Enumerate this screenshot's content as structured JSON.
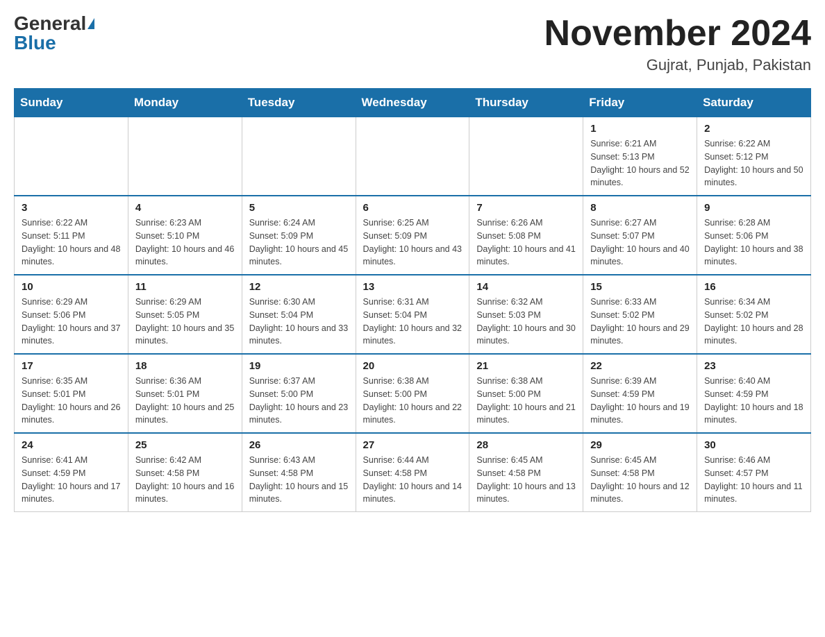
{
  "header": {
    "logo_general": "General",
    "logo_blue": "Blue",
    "month_title": "November 2024",
    "location": "Gujrat, Punjab, Pakistan"
  },
  "weekdays": [
    "Sunday",
    "Monday",
    "Tuesday",
    "Wednesday",
    "Thursday",
    "Friday",
    "Saturday"
  ],
  "weeks": [
    [
      {
        "day": "",
        "info": ""
      },
      {
        "day": "",
        "info": ""
      },
      {
        "day": "",
        "info": ""
      },
      {
        "day": "",
        "info": ""
      },
      {
        "day": "",
        "info": ""
      },
      {
        "day": "1",
        "info": "Sunrise: 6:21 AM\nSunset: 5:13 PM\nDaylight: 10 hours and 52 minutes."
      },
      {
        "day": "2",
        "info": "Sunrise: 6:22 AM\nSunset: 5:12 PM\nDaylight: 10 hours and 50 minutes."
      }
    ],
    [
      {
        "day": "3",
        "info": "Sunrise: 6:22 AM\nSunset: 5:11 PM\nDaylight: 10 hours and 48 minutes."
      },
      {
        "day": "4",
        "info": "Sunrise: 6:23 AM\nSunset: 5:10 PM\nDaylight: 10 hours and 46 minutes."
      },
      {
        "day": "5",
        "info": "Sunrise: 6:24 AM\nSunset: 5:09 PM\nDaylight: 10 hours and 45 minutes."
      },
      {
        "day": "6",
        "info": "Sunrise: 6:25 AM\nSunset: 5:09 PM\nDaylight: 10 hours and 43 minutes."
      },
      {
        "day": "7",
        "info": "Sunrise: 6:26 AM\nSunset: 5:08 PM\nDaylight: 10 hours and 41 minutes."
      },
      {
        "day": "8",
        "info": "Sunrise: 6:27 AM\nSunset: 5:07 PM\nDaylight: 10 hours and 40 minutes."
      },
      {
        "day": "9",
        "info": "Sunrise: 6:28 AM\nSunset: 5:06 PM\nDaylight: 10 hours and 38 minutes."
      }
    ],
    [
      {
        "day": "10",
        "info": "Sunrise: 6:29 AM\nSunset: 5:06 PM\nDaylight: 10 hours and 37 minutes."
      },
      {
        "day": "11",
        "info": "Sunrise: 6:29 AM\nSunset: 5:05 PM\nDaylight: 10 hours and 35 minutes."
      },
      {
        "day": "12",
        "info": "Sunrise: 6:30 AM\nSunset: 5:04 PM\nDaylight: 10 hours and 33 minutes."
      },
      {
        "day": "13",
        "info": "Sunrise: 6:31 AM\nSunset: 5:04 PM\nDaylight: 10 hours and 32 minutes."
      },
      {
        "day": "14",
        "info": "Sunrise: 6:32 AM\nSunset: 5:03 PM\nDaylight: 10 hours and 30 minutes."
      },
      {
        "day": "15",
        "info": "Sunrise: 6:33 AM\nSunset: 5:02 PM\nDaylight: 10 hours and 29 minutes."
      },
      {
        "day": "16",
        "info": "Sunrise: 6:34 AM\nSunset: 5:02 PM\nDaylight: 10 hours and 28 minutes."
      }
    ],
    [
      {
        "day": "17",
        "info": "Sunrise: 6:35 AM\nSunset: 5:01 PM\nDaylight: 10 hours and 26 minutes."
      },
      {
        "day": "18",
        "info": "Sunrise: 6:36 AM\nSunset: 5:01 PM\nDaylight: 10 hours and 25 minutes."
      },
      {
        "day": "19",
        "info": "Sunrise: 6:37 AM\nSunset: 5:00 PM\nDaylight: 10 hours and 23 minutes."
      },
      {
        "day": "20",
        "info": "Sunrise: 6:38 AM\nSunset: 5:00 PM\nDaylight: 10 hours and 22 minutes."
      },
      {
        "day": "21",
        "info": "Sunrise: 6:38 AM\nSunset: 5:00 PM\nDaylight: 10 hours and 21 minutes."
      },
      {
        "day": "22",
        "info": "Sunrise: 6:39 AM\nSunset: 4:59 PM\nDaylight: 10 hours and 19 minutes."
      },
      {
        "day": "23",
        "info": "Sunrise: 6:40 AM\nSunset: 4:59 PM\nDaylight: 10 hours and 18 minutes."
      }
    ],
    [
      {
        "day": "24",
        "info": "Sunrise: 6:41 AM\nSunset: 4:59 PM\nDaylight: 10 hours and 17 minutes."
      },
      {
        "day": "25",
        "info": "Sunrise: 6:42 AM\nSunset: 4:58 PM\nDaylight: 10 hours and 16 minutes."
      },
      {
        "day": "26",
        "info": "Sunrise: 6:43 AM\nSunset: 4:58 PM\nDaylight: 10 hours and 15 minutes."
      },
      {
        "day": "27",
        "info": "Sunrise: 6:44 AM\nSunset: 4:58 PM\nDaylight: 10 hours and 14 minutes."
      },
      {
        "day": "28",
        "info": "Sunrise: 6:45 AM\nSunset: 4:58 PM\nDaylight: 10 hours and 13 minutes."
      },
      {
        "day": "29",
        "info": "Sunrise: 6:45 AM\nSunset: 4:58 PM\nDaylight: 10 hours and 12 minutes."
      },
      {
        "day": "30",
        "info": "Sunrise: 6:46 AM\nSunset: 4:57 PM\nDaylight: 10 hours and 11 minutes."
      }
    ]
  ]
}
